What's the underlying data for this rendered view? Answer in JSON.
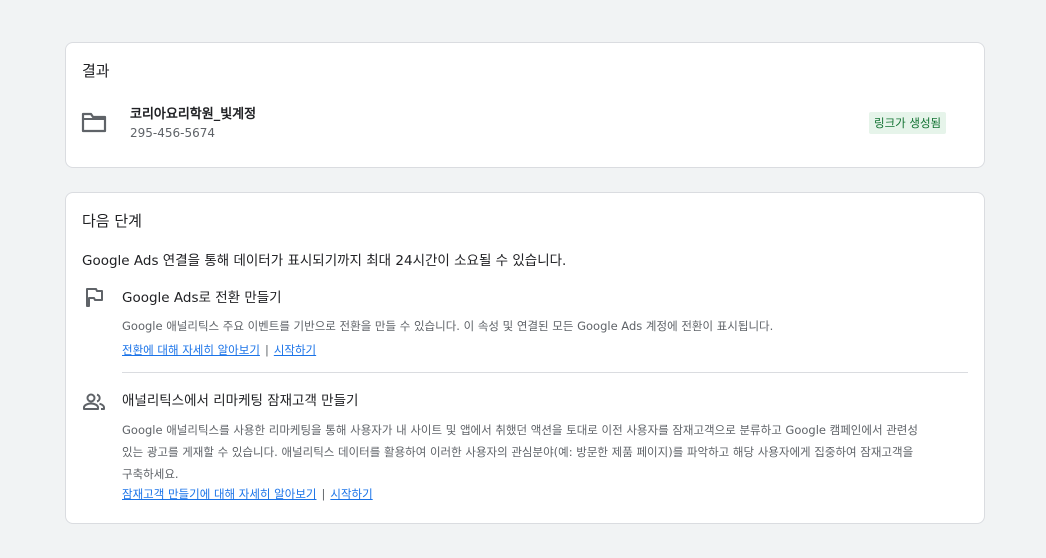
{
  "result": {
    "title": "결과",
    "account_name": "코리아요리학원_빛계정",
    "account_id": "295-456-5674",
    "status_badge": "링크가 생성됨"
  },
  "next_steps": {
    "title": "다음 단계",
    "intro": "Google Ads 연결을 통해 데이터가 표시되기까지 최대 24시간이 소요될 수 있습니다.",
    "steps": [
      {
        "icon": "flag-icon",
        "title": "Google Ads로 전환 만들기",
        "description": "Google 애널리틱스 주요 이벤트를 기반으로 전환을 만들 수 있습니다. 이 속성 및 연결된 모든 Google Ads 계정에 전환이 표시됩니다.",
        "learn_more": "전환에 대해 자세히 알아보기",
        "separator": "|",
        "get_started": "시작하기"
      },
      {
        "icon": "people-icon",
        "title": "애널리틱스에서 리마케팅 잠재고객 만들기",
        "description": "Google 애널리틱스를 사용한 리마케팅을 통해 사용자가 내 사이트 및 앱에서 취했던 액션을 토대로 이전 사용자를 잠재고객으로 분류하고 Google 캠페인에서 관련성 있는 광고를 게재할 수 있습니다. 애널리틱스 데이터를 활용하여 이러한 사용자의 관심분야(예: 방문한 제품 페이지)를 파악하고 해당 사용자에게 집중하여 잠재고객을 구축하세요.",
        "learn_more": "잠재고객 만들기에 대해 자세히 알아보기",
        "separator": "|",
        "get_started": "시작하기"
      }
    ]
  }
}
